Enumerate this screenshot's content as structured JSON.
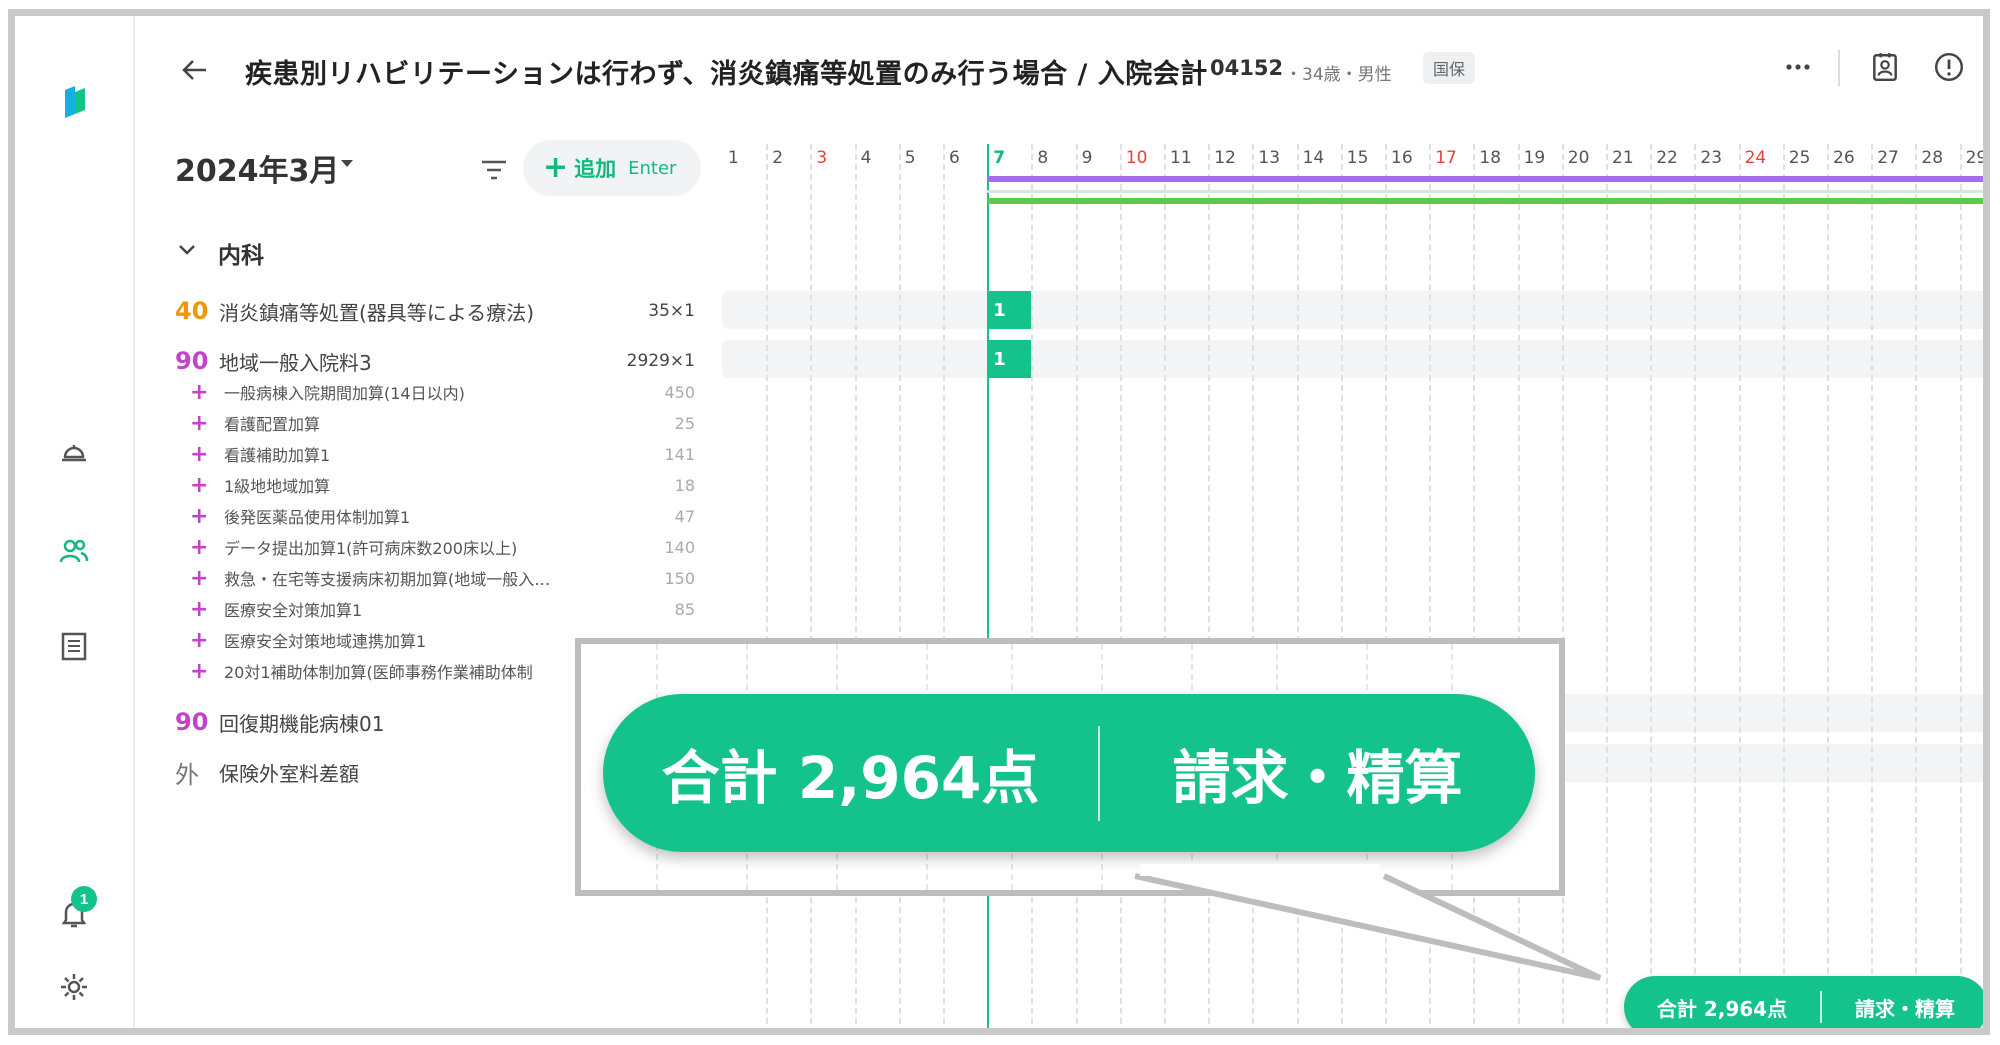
{
  "header": {
    "title": "疾患別リハビリテーションは行わず、消炎鎮痛等処置のみ行う場合 / 入院会計",
    "patient_id": "04152",
    "patient_meta": "・34歳・男性",
    "insurance": "国保",
    "back_icon": "arrow-left-icon",
    "more_icon": "more-horizontal-icon",
    "patient_card_icon": "id-card-icon",
    "alert_icon": "alert-circle-icon"
  },
  "sidebar": {
    "logo_icon": "app-logo-icon",
    "items": [
      {
        "icon": "reception-bell-icon"
      },
      {
        "icon": "patients-icon"
      },
      {
        "icon": "document-list-icon"
      }
    ],
    "notification_count": "1",
    "notification_icon": "bell-icon",
    "settings_icon": "gear-icon"
  },
  "toolbar": {
    "month": "2024年3月",
    "filter_icon": "filter-icon",
    "add_label": "追加",
    "add_shortcut": "Enter"
  },
  "section": {
    "name": "内科",
    "main_items": [
      {
        "code": "40",
        "code_color": "#f0960a",
        "name": "消炎鎮痛等処置(器具等による療法)",
        "qty": "35×1"
      },
      {
        "code": "90",
        "code_color": "#c245c9",
        "name": "地域一般入院料3",
        "qty": "2929×1"
      }
    ],
    "sub_items": [
      {
        "name": "一般病棟入院期間加算(14日以内)",
        "points": "450"
      },
      {
        "name": "看護配置加算",
        "points": "25"
      },
      {
        "name": "看護補助加算1",
        "points": "141"
      },
      {
        "name": "1級地地域加算",
        "points": "18"
      },
      {
        "name": "後発医薬品使用体制加算1",
        "points": "47"
      },
      {
        "name": "データ提出加算1(許可病床数200床以上)",
        "points": "140"
      },
      {
        "name": "救急・在宅等支援病床初期加算(地域一般入…",
        "points": "150"
      },
      {
        "name": "医療安全対策加算1",
        "points": "85"
      },
      {
        "name": "医療安全対策地域連携加算1",
        "points": ""
      },
      {
        "name": "20対1補助体制加算(医師事務作業補助体制",
        "points": ""
      }
    ],
    "extra_items": [
      {
        "code": "90",
        "code_color": "#c245c9",
        "name": "回復期機能病棟01"
      },
      {
        "code": "外",
        "code_color": "#777777",
        "name": "保険外室料差額"
      }
    ]
  },
  "calendar": {
    "days": [
      "1",
      "2",
      "3",
      "4",
      "5",
      "6",
      "7",
      "8",
      "9",
      "10",
      "11",
      "12",
      "13",
      "14",
      "15",
      "16",
      "17",
      "18",
      "19",
      "20",
      "21",
      "22",
      "23",
      "24",
      "25",
      "26",
      "27",
      "28",
      "29"
    ],
    "red_days": [
      "3",
      "10",
      "17",
      "24"
    ],
    "today": "7",
    "marks": [
      {
        "row": 0,
        "day": "7",
        "value": "1"
      },
      {
        "row": 1,
        "day": "7",
        "value": "1"
      }
    ],
    "stay_bar_colors": [
      "#a56cf0",
      "#5cc94a"
    ]
  },
  "callout": {
    "total": "合計 2,964点",
    "action": "請求・精算"
  },
  "footer": {
    "total": "合計 2,964点",
    "action": "請求・精算"
  },
  "colors": {
    "accent": "#13c38b",
    "highlight_underline": "#e8141c"
  }
}
